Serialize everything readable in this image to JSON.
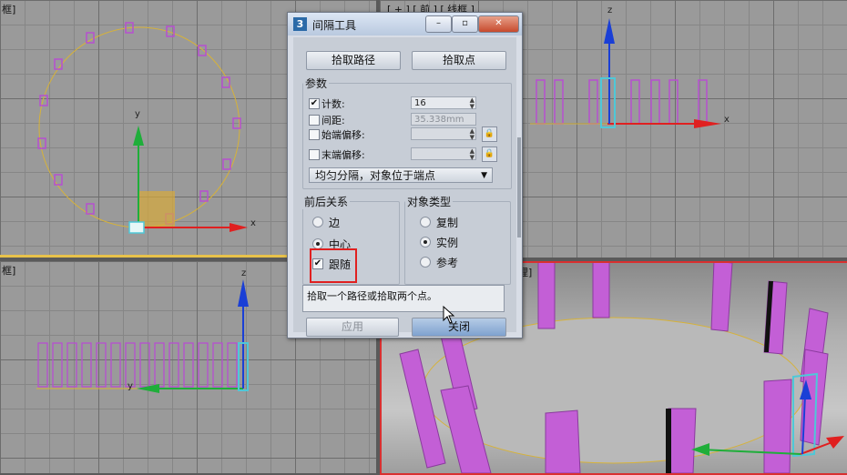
{
  "viewports": {
    "top_left_label": "框]",
    "top_right_label": "[ + ] [ 前 ] [ 线框 ]",
    "bottom_left_label": "框]",
    "bottom_right_label": "理]"
  },
  "axes": {
    "x": "x",
    "y": "y",
    "z": "z"
  },
  "dialog": {
    "icon": "3",
    "title": "间隔工具",
    "pick_path": "拾取路径",
    "pick_points": "拾取点",
    "params_title": "参数",
    "count_label": "计数:",
    "count_value": "16",
    "spacing_label": "间距:",
    "spacing_value": "35.338mm",
    "start_offset_label": "始端偏移:",
    "end_offset_label": "末端偏移:",
    "distribution_mode": "均匀分隔，对象位于端点",
    "context_title": "前后关系",
    "context_options": [
      "边",
      "中心",
      "跟随"
    ],
    "object_type_title": "对象类型",
    "object_types": [
      "复制",
      "实例",
      "参考"
    ],
    "status_text": "拾取一个路径或拾取两个点。",
    "apply": "应用",
    "close": "关闭",
    "check": "✔",
    "lock": "🔒",
    "spin_arrows": "▲▼",
    "dropdown_arrow": "▼"
  },
  "colors": {
    "accent": "#e02020",
    "object": "#b64fd0",
    "path": "#d6b23a",
    "x_axis": "#e02020",
    "y_axis": "#1fae3a",
    "z_axis": "#1a3fd6"
  }
}
